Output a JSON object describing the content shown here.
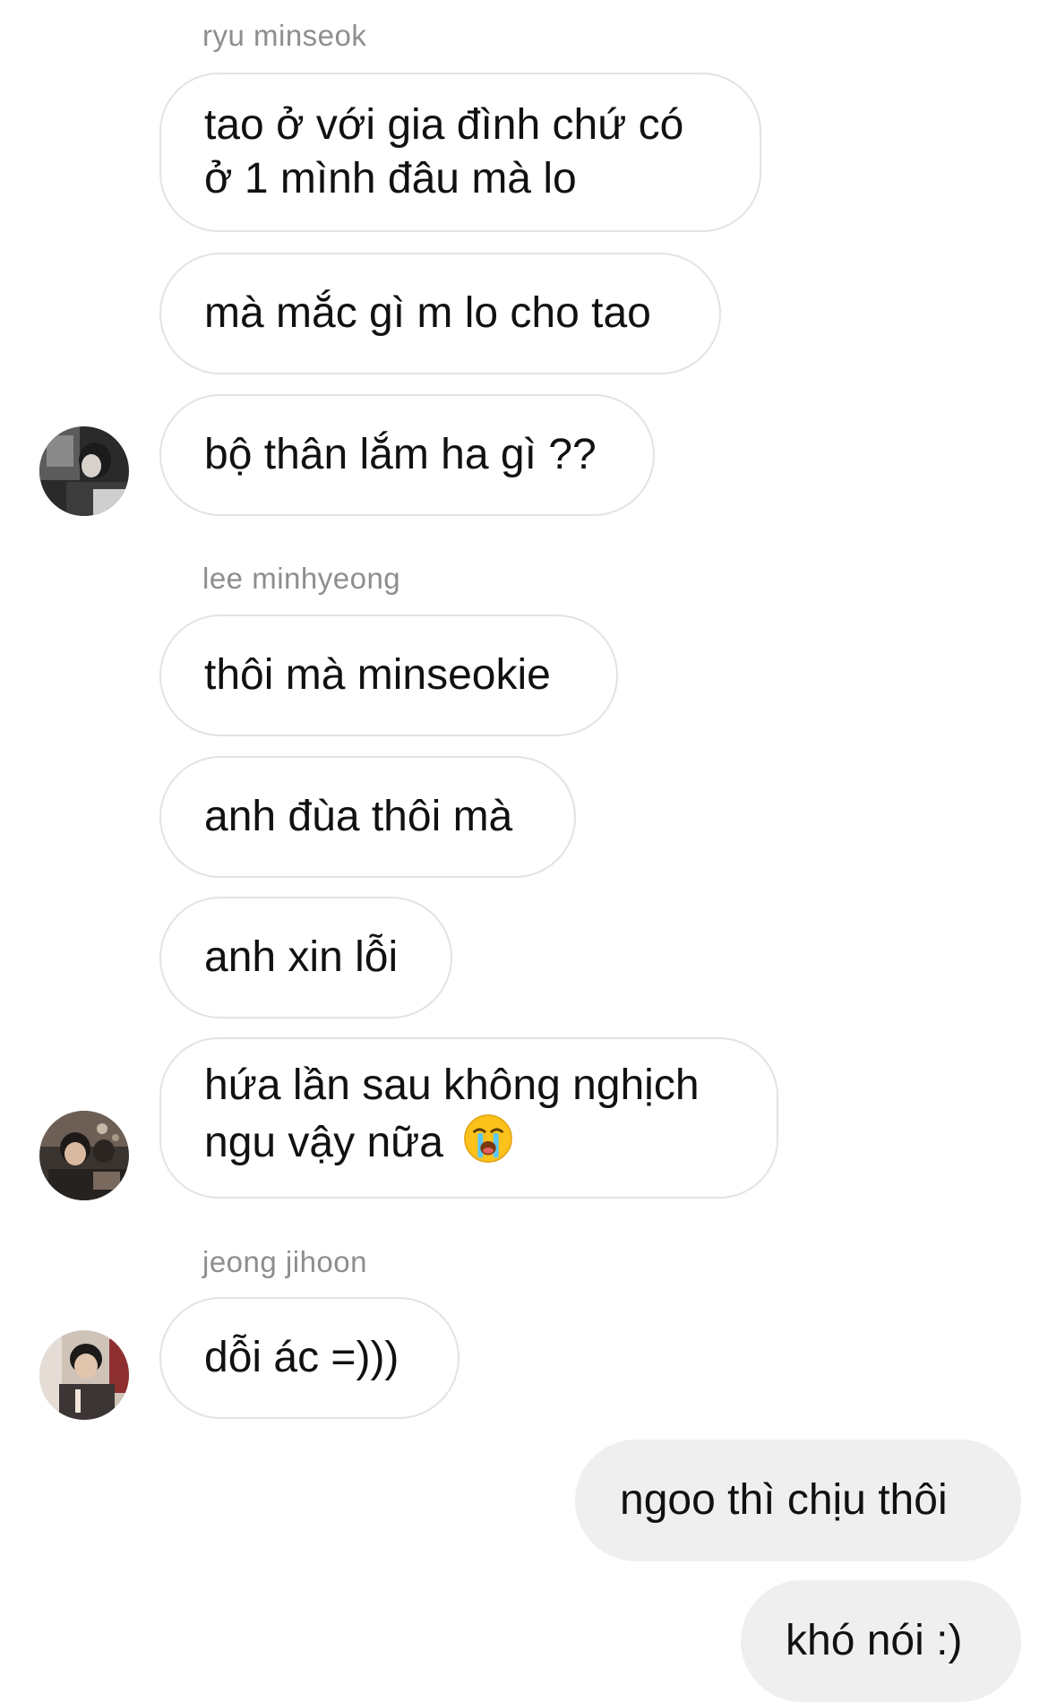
{
  "thread": {
    "groups": [
      {
        "sender": "ryu minseok",
        "messages": [
          "tao ở với gia đình chứ có ở 1 mình đâu mà lo",
          "mà mắc gì m lo cho tao",
          "bộ thân lắm ha gì ??"
        ]
      },
      {
        "sender": "lee minhyeong",
        "messages": [
          "thôi mà minseokie",
          "anh đùa thôi mà",
          "anh xin lỗi",
          "hứa lần sau không nghịch ngu vậy nữa"
        ],
        "emoji": "loudly-crying-face-icon"
      },
      {
        "sender": "jeong jihoon",
        "messages": [
          "dỗi ác =)))"
        ]
      }
    ],
    "outgoing": [
      "ngoo thì chịu thôi",
      "khó nói :)"
    ]
  },
  "colors": {
    "sender_label": "#8e8e8e",
    "incoming_border": "#e3e3e3",
    "outgoing_bg": "#efefef",
    "text": "#111111"
  }
}
